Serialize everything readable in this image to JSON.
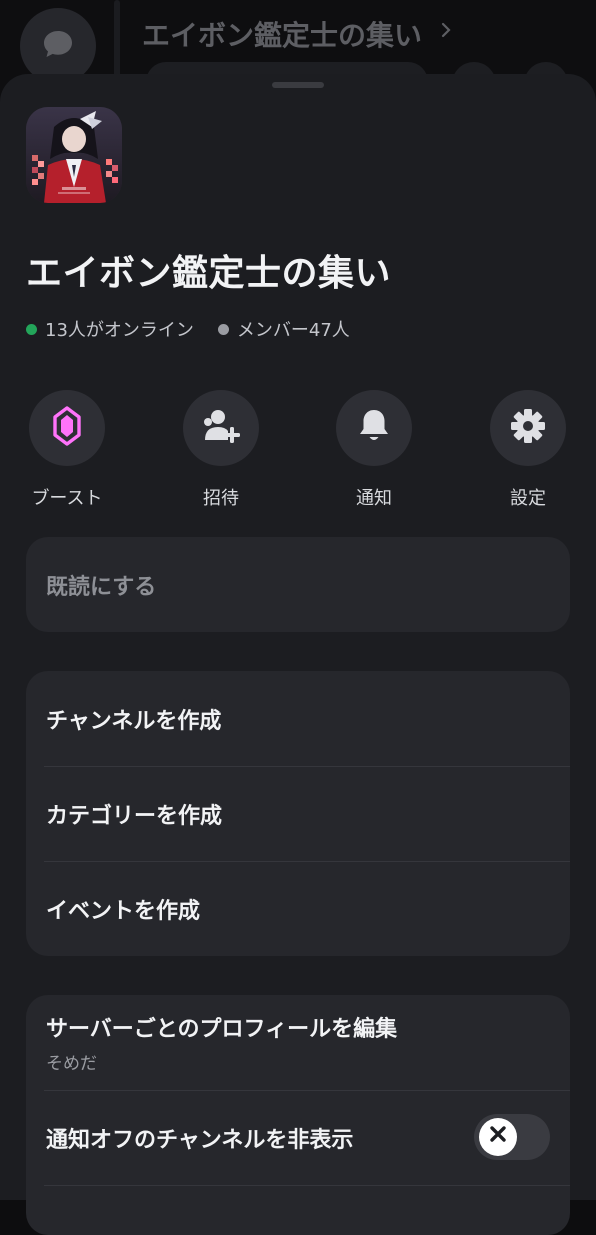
{
  "background": {
    "title": "エイボン鑑定士の集い"
  },
  "server": {
    "name": "エイボン鑑定士の集い",
    "online": "13人がオンライン",
    "members": "メンバー47人",
    "online_color": "#23a55a",
    "members_color": "#9a9ca2"
  },
  "actions": [
    {
      "label": "ブースト",
      "icon": "boost-gem-icon",
      "color": "#ff73fa"
    },
    {
      "label": "招待",
      "icon": "add-user-icon",
      "color": "#dfe0e4"
    },
    {
      "label": "通知",
      "icon": "bell-icon",
      "color": "#dfe0e4"
    },
    {
      "label": "設定",
      "icon": "gear-icon",
      "color": "#dfe0e4"
    }
  ],
  "mark_read": {
    "label": "既読にする"
  },
  "create": {
    "channel": "チャンネルを作成",
    "category": "カテゴリーを作成",
    "event": "イベントを作成"
  },
  "settings": {
    "edit_profile": "サーバーごとのプロフィールを編集",
    "profile_name": "そめだ",
    "hide_muted": "通知オフのチャンネルを非表示",
    "hide_muted_enabled": false
  }
}
